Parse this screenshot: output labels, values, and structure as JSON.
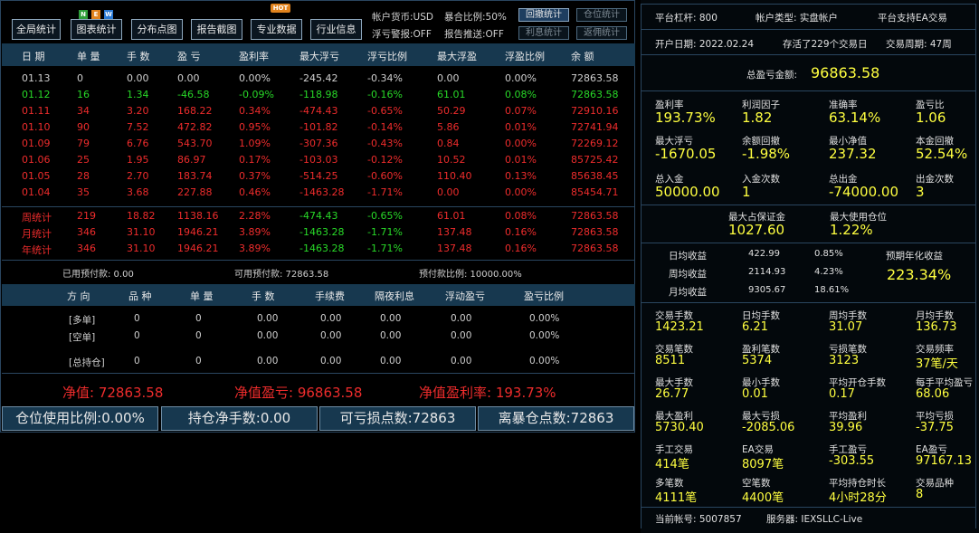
{
  "toolbar": {
    "buttons": [
      "全局统计",
      "图表统计",
      "分布点图",
      "报告截图",
      "专业数据",
      "行业信息"
    ],
    "badge_new": [
      "N",
      "E",
      "W"
    ],
    "badge_hot": "HOT",
    "info": {
      "currency": "帐户货币:USD",
      "explode_ratio": "暴合比例:50%",
      "float_warning": "浮亏警报:OFF",
      "report_push": "报告推送:OFF"
    },
    "stat_buttons": [
      "回撤统计",
      "仓位统计",
      "利息统计",
      "返佣统计"
    ]
  },
  "table": {
    "headers": [
      "日 期",
      "单 量",
      "手 数",
      "盈 亏",
      "盈利率",
      "最大浮亏",
      "浮亏比例",
      "最大浮盈",
      "浮盈比例",
      "余 额"
    ],
    "rows": [
      {
        "cls": "gray",
        "cells": [
          "01.13",
          "0",
          "0.00",
          "0.00",
          "0.00%",
          "-245.42",
          "-0.34%",
          "0.00",
          "0.00%",
          "72863.58"
        ]
      },
      {
        "cls": "green",
        "cells": [
          "01.12",
          "16",
          "1.34",
          "-46.58",
          "-0.09%",
          "-118.98",
          "-0.16%",
          "61.01",
          "0.08%",
          "72863.58"
        ]
      },
      {
        "cls": "red",
        "cells": [
          "01.11",
          "34",
          "3.20",
          "168.22",
          "0.34%",
          "-474.43",
          "-0.65%",
          "50.29",
          "0.07%",
          "72910.16"
        ]
      },
      {
        "cls": "red",
        "cells": [
          "01.10",
          "90",
          "7.52",
          "472.82",
          "0.95%",
          "-101.82",
          "-0.14%",
          "5.86",
          "0.01%",
          "72741.94"
        ]
      },
      {
        "cls": "red",
        "cells": [
          "01.09",
          "79",
          "6.76",
          "543.70",
          "1.09%",
          "-307.36",
          "-0.43%",
          "0.84",
          "0.00%",
          "72269.12"
        ]
      },
      {
        "cls": "red",
        "cells": [
          "01.06",
          "25",
          "1.95",
          "86.97",
          "0.17%",
          "-103.03",
          "-0.12%",
          "10.52",
          "0.01%",
          "85725.42"
        ]
      },
      {
        "cls": "red",
        "cells": [
          "01.05",
          "28",
          "2.70",
          "183.74",
          "0.37%",
          "-514.25",
          "-0.60%",
          "110.40",
          "0.13%",
          "85638.45"
        ]
      },
      {
        "cls": "red",
        "cells": [
          "01.04",
          "35",
          "3.68",
          "227.88",
          "0.46%",
          "-1463.28",
          "-1.71%",
          "0.00",
          "0.00%",
          "85454.71"
        ]
      }
    ],
    "summary": [
      {
        "cells": [
          "周统计",
          "219",
          "18.82",
          "1138.16",
          "2.28%",
          "-474.43",
          "-0.65%",
          "61.01",
          "0.08%",
          "72863.58"
        ]
      },
      {
        "cells": [
          "月统计",
          "346",
          "31.10",
          "1946.21",
          "3.89%",
          "-1463.28",
          "-1.71%",
          "137.48",
          "0.16%",
          "72863.58"
        ]
      },
      {
        "cells": [
          "年统计",
          "346",
          "31.10",
          "1946.21",
          "3.89%",
          "-1463.28",
          "-1.71%",
          "137.48",
          "0.16%",
          "72863.58"
        ]
      }
    ]
  },
  "prepaid": {
    "used": "已用预付款: 0.00",
    "available": "可用预付款: 72863.58",
    "ratio": "预付款比例: 10000.00%"
  },
  "positions": {
    "headers": [
      "方 向",
      "品 种",
      "单 量",
      "手 数",
      "手续费",
      "隔夜利息",
      "浮动盈亏",
      "盈亏比例"
    ],
    "rows": [
      [
        "[多单]",
        "0",
        "0",
        "0.00",
        "0.00",
        "0.00",
        "0.00",
        "0.00%"
      ],
      [
        "[空单]",
        "0",
        "0",
        "0.00",
        "0.00",
        "0.00",
        "0.00",
        "0.00%"
      ],
      [
        "[总持仓]",
        "0",
        "0",
        "0.00",
        "0.00",
        "0.00",
        "0.00",
        "0.00%"
      ]
    ]
  },
  "net": {
    "equity": "净值: 72863.58",
    "equity_pl": "净值盈亏: 96863.58",
    "equity_rate": "净值盈利率: 193.73%"
  },
  "bottom": [
    "仓位使用比例:0.00%",
    "持仓净手数:0.00",
    "可亏损点数:72863",
    "离暴仓点数:72863"
  ],
  "right": {
    "leverage": "平台杠杆: 800",
    "account_type": "帐户类型: 实盘帐户",
    "ea_support": "平台支持EA交易",
    "open_date": "开户日期: 2022.02.24",
    "days": "存活了229个交易日",
    "period": "交易周期: 47周",
    "total_pl_label": "总盈亏金额:",
    "total_pl_value": "96863.58",
    "metrics": [
      [
        [
          "盈利率",
          "193.73%"
        ],
        [
          "利润因子",
          "1.82"
        ],
        [
          "准确率",
          "63.14%"
        ],
        [
          "盈亏比",
          "1.06"
        ]
      ],
      [
        [
          "最大浮亏",
          "-1670.05"
        ],
        [
          "余额回撤",
          "-1.98%"
        ],
        [
          "最小净值",
          "237.32"
        ],
        [
          "本金回撤",
          "52.54%"
        ]
      ],
      [
        [
          "总入金",
          "50000.00"
        ],
        [
          "入金次数",
          "1"
        ],
        [
          "总出金",
          "-74000.00"
        ],
        [
          "出金次数",
          "3"
        ]
      ]
    ],
    "margin": [
      [
        "最大占保证金",
        "1027.60"
      ],
      [
        "最大使用仓位",
        "1.22%"
      ]
    ],
    "avg": [
      [
        "日均收益",
        "422.99",
        "0.85%"
      ],
      [
        "周均收益",
        "2114.93",
        "4.23%"
      ],
      [
        "月均收益",
        "9305.67",
        "18.61%"
      ]
    ],
    "annual_label": "预期年化收益",
    "annual_value": "223.34%",
    "stats": [
      [
        [
          "交易手数",
          "1423.21"
        ],
        [
          "日均手数",
          "6.21"
        ],
        [
          "周均手数",
          "31.07"
        ],
        [
          "月均手数",
          "136.73"
        ]
      ],
      [
        [
          "交易笔数",
          "8511"
        ],
        [
          "盈利笔数",
          "5374"
        ],
        [
          "亏损笔数",
          "3123"
        ],
        [
          "交易频率",
          "37笔/天"
        ]
      ],
      [
        [
          "最大手数",
          "26.77"
        ],
        [
          "最小手数",
          "0.01"
        ],
        [
          "平均开仓手数",
          "0.17"
        ],
        [
          "每手平均盈亏",
          "68.06"
        ]
      ],
      [
        [
          "最大盈利",
          "5730.40"
        ],
        [
          "最大亏损",
          "-2085.06"
        ],
        [
          "平均盈利",
          "39.96"
        ],
        [
          "平均亏损",
          "-37.75"
        ]
      ],
      [
        [
          "手工交易",
          "414笔"
        ],
        [
          "EA交易",
          "8097笔"
        ],
        [
          "手工盈亏",
          "-303.55"
        ],
        [
          "EA盈亏",
          "97167.13"
        ]
      ],
      [
        [
          "多笔数",
          "4111笔"
        ],
        [
          "空笔数",
          "4400笔"
        ],
        [
          "平均持仓时长",
          "4小时28分"
        ],
        [
          "交易品种",
          "8"
        ]
      ]
    ],
    "account": "当前帐号: 5007857",
    "server": "服务器: IEXSLLC-Live"
  },
  "colors": {
    "accent": "#17384f",
    "profit": "#ee2c2c",
    "loss": "#28d828",
    "value": "#ffff40"
  }
}
